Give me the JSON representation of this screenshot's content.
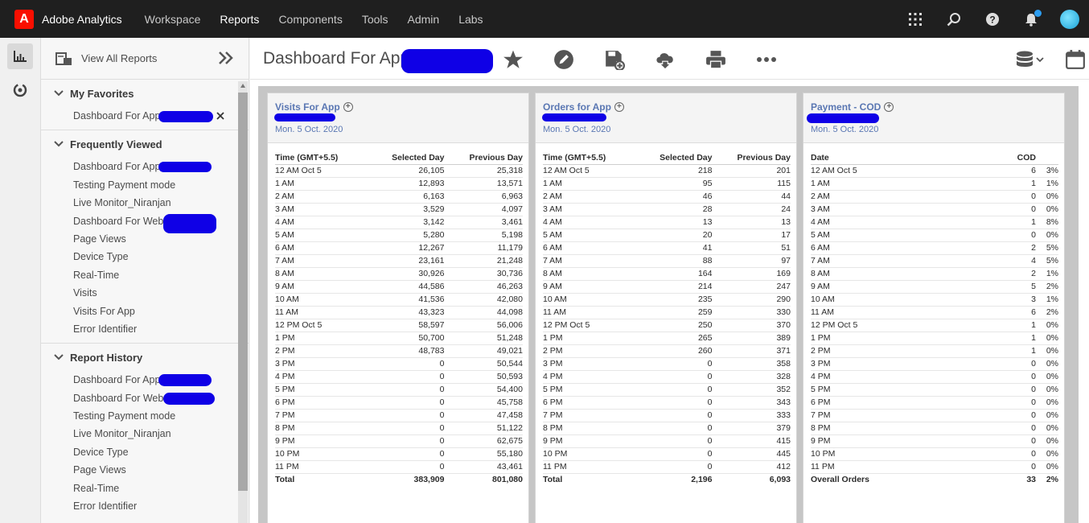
{
  "topbar": {
    "app_name": "Adobe Analytics",
    "nav": [
      "Workspace",
      "Reports",
      "Components",
      "Tools",
      "Admin",
      "Labs"
    ],
    "active_nav": "Reports"
  },
  "panel": {
    "view_all": "View All Reports",
    "favorites": {
      "title": "My Favorites",
      "items": [
        "Dashboard For App"
      ]
    },
    "frequent": {
      "title": "Frequently Viewed",
      "items": [
        "Dashboard For App",
        "Testing Payment mode",
        "Live Monitor_Niranjan",
        "Dashboard For Web (",
        "Page Views",
        "Device Type",
        "Real-Time",
        "Visits",
        "Visits For App",
        "Error Identifier"
      ]
    },
    "history": {
      "title": "Report History",
      "items": [
        "Dashboard For App",
        "Dashboard For Web (",
        "Testing Payment mode",
        "Live Monitor_Niranjan",
        "Device Type",
        "Page Views",
        "Real-Time",
        "Error Identifier"
      ]
    }
  },
  "main": {
    "title": "Dashboard For App"
  },
  "cards": [
    {
      "title": "Visits For App",
      "date": "Mon. 5 Oct. 2020",
      "headers": [
        "Time (GMT+5.5)",
        "Selected Day",
        "Previous Day"
      ],
      "rows": [
        [
          "12 AM Oct 5",
          "26,105",
          "25,318"
        ],
        [
          "1 AM",
          "12,893",
          "13,571"
        ],
        [
          "2 AM",
          "6,163",
          "6,963"
        ],
        [
          "3 AM",
          "3,529",
          "4,097"
        ],
        [
          "4 AM",
          "3,142",
          "3,461"
        ],
        [
          "5 AM",
          "5,280",
          "5,198"
        ],
        [
          "6 AM",
          "12,267",
          "11,179"
        ],
        [
          "7 AM",
          "23,161",
          "21,248"
        ],
        [
          "8 AM",
          "30,926",
          "30,736"
        ],
        [
          "9 AM",
          "44,586",
          "46,263"
        ],
        [
          "10 AM",
          "41,536",
          "42,080"
        ],
        [
          "11 AM",
          "43,323",
          "44,098"
        ],
        [
          "12 PM Oct 5",
          "58,597",
          "56,006"
        ],
        [
          "1 PM",
          "50,700",
          "51,248"
        ],
        [
          "2 PM",
          "48,783",
          "49,021"
        ],
        [
          "3 PM",
          "0",
          "50,544"
        ],
        [
          "4 PM",
          "0",
          "50,593"
        ],
        [
          "5 PM",
          "0",
          "54,400"
        ],
        [
          "6 PM",
          "0",
          "45,758"
        ],
        [
          "7 PM",
          "0",
          "47,458"
        ],
        [
          "8 PM",
          "0",
          "51,122"
        ],
        [
          "9 PM",
          "0",
          "62,675"
        ],
        [
          "10 PM",
          "0",
          "55,180"
        ],
        [
          "11 PM",
          "0",
          "43,461"
        ]
      ],
      "total": [
        "Total",
        "383,909",
        "801,080"
      ]
    },
    {
      "title": "Orders for App",
      "date": "Mon. 5 Oct. 2020",
      "headers": [
        "Time (GMT+5.5)",
        "Selected Day",
        "Previous Day"
      ],
      "rows": [
        [
          "12 AM Oct 5",
          "218",
          "201"
        ],
        [
          "1 AM",
          "95",
          "115"
        ],
        [
          "2 AM",
          "46",
          "44"
        ],
        [
          "3 AM",
          "28",
          "24"
        ],
        [
          "4 AM",
          "13",
          "13"
        ],
        [
          "5 AM",
          "20",
          "17"
        ],
        [
          "6 AM",
          "41",
          "51"
        ],
        [
          "7 AM",
          "88",
          "97"
        ],
        [
          "8 AM",
          "164",
          "169"
        ],
        [
          "9 AM",
          "214",
          "247"
        ],
        [
          "10 AM",
          "235",
          "290"
        ],
        [
          "11 AM",
          "259",
          "330"
        ],
        [
          "12 PM Oct 5",
          "250",
          "370"
        ],
        [
          "1 PM",
          "265",
          "389"
        ],
        [
          "2 PM",
          "260",
          "371"
        ],
        [
          "3 PM",
          "0",
          "358"
        ],
        [
          "4 PM",
          "0",
          "328"
        ],
        [
          "5 PM",
          "0",
          "352"
        ],
        [
          "6 PM",
          "0",
          "343"
        ],
        [
          "7 PM",
          "0",
          "333"
        ],
        [
          "8 PM",
          "0",
          "379"
        ],
        [
          "9 PM",
          "0",
          "415"
        ],
        [
          "10 PM",
          "0",
          "445"
        ],
        [
          "11 PM",
          "0",
          "412"
        ]
      ],
      "total": [
        "Total",
        "2,196",
        "6,093"
      ]
    },
    {
      "title": "Payment - COD",
      "date": "Mon. 5 Oct. 2020",
      "headers": [
        "Date",
        "COD",
        ""
      ],
      "rows": [
        [
          "12 AM Oct 5",
          "6",
          "3%"
        ],
        [
          "1 AM",
          "1",
          "1%"
        ],
        [
          "2 AM",
          "0",
          "0%"
        ],
        [
          "3 AM",
          "0",
          "0%"
        ],
        [
          "4 AM",
          "1",
          "8%"
        ],
        [
          "5 AM",
          "0",
          "0%"
        ],
        [
          "6 AM",
          "2",
          "5%"
        ],
        [
          "7 AM",
          "4",
          "5%"
        ],
        [
          "8 AM",
          "2",
          "1%"
        ],
        [
          "9 AM",
          "5",
          "2%"
        ],
        [
          "10 AM",
          "3",
          "1%"
        ],
        [
          "11 AM",
          "6",
          "2%"
        ],
        [
          "12 PM Oct 5",
          "1",
          "0%"
        ],
        [
          "1 PM",
          "1",
          "0%"
        ],
        [
          "2 PM",
          "1",
          "0%"
        ],
        [
          "3 PM",
          "0",
          "0%"
        ],
        [
          "4 PM",
          "0",
          "0%"
        ],
        [
          "5 PM",
          "0",
          "0%"
        ],
        [
          "6 PM",
          "0",
          "0%"
        ],
        [
          "7 PM",
          "0",
          "0%"
        ],
        [
          "8 PM",
          "0",
          "0%"
        ],
        [
          "9 PM",
          "0",
          "0%"
        ],
        [
          "10 PM",
          "0",
          "0%"
        ],
        [
          "11 PM",
          "0",
          "0%"
        ]
      ],
      "total": [
        "Overall Orders",
        "33",
        "2%"
      ]
    }
  ]
}
